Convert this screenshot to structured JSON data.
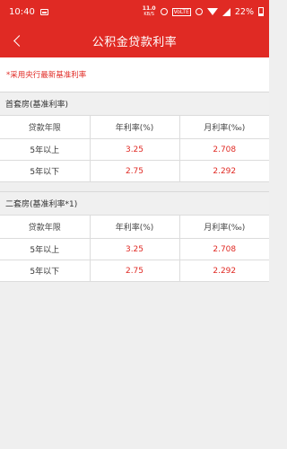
{
  "status_bar": {
    "time": "10:40",
    "net_speed": "11.0",
    "net_unit": "KB/S",
    "volte": "VoLTE",
    "battery": "22%"
  },
  "header": {
    "title": "公积金贷款利率"
  },
  "notice": "*采用央行最新基准利率",
  "sections": [
    {
      "title": "首套房(基准利率)",
      "columns": [
        "贷款年限",
        "年利率(%)",
        "月利率(‰)"
      ],
      "rows": [
        {
          "term": "5年以上",
          "annual": "3.25",
          "monthly": "2.708"
        },
        {
          "term": "5年以下",
          "annual": "2.75",
          "monthly": "2.292"
        }
      ]
    },
    {
      "title": "二套房(基准利率*1)",
      "columns": [
        "贷款年限",
        "年利率(%)",
        "月利率(‰)"
      ],
      "rows": [
        {
          "term": "5年以上",
          "annual": "3.25",
          "monthly": "2.708"
        },
        {
          "term": "5年以下",
          "annual": "2.75",
          "monthly": "2.292"
        }
      ]
    }
  ],
  "colors": {
    "brand_red": "#e02a24",
    "background": "#efefef"
  }
}
